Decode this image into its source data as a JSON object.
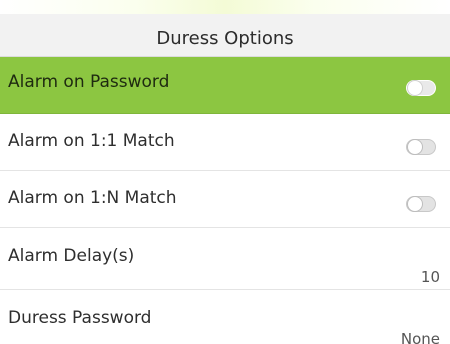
{
  "header": {
    "title": "Duress Options"
  },
  "rows": [
    {
      "label": "Alarm on Password",
      "type": "toggle",
      "checked": false,
      "selected": true
    },
    {
      "label": "Alarm on 1:1 Match",
      "type": "toggle",
      "checked": false,
      "selected": false
    },
    {
      "label": "Alarm on 1:N Match",
      "type": "toggle",
      "checked": false,
      "selected": false
    },
    {
      "label": "Alarm Delay(s)",
      "type": "value",
      "value": "10"
    },
    {
      "label": "Duress Password",
      "type": "value",
      "value": "None"
    }
  ],
  "colors": {
    "selected_row": "#8cc641",
    "header_bg": "#f2f2f2",
    "toggle_off": "#e3e3e3"
  },
  "icons": {
    "toggle": "toggle-switch-icon"
  }
}
